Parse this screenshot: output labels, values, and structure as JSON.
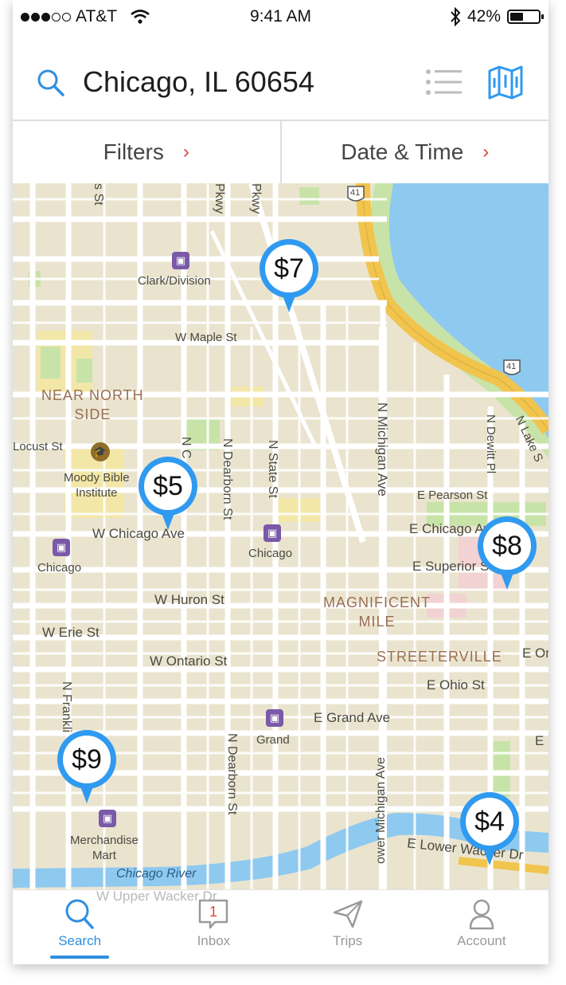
{
  "status_bar": {
    "carrier": "AT&T",
    "time": "9:41 AM",
    "battery": "42%",
    "battery_level": 0.42
  },
  "header": {
    "location": "Chicago, IL 60654"
  },
  "filters": {
    "filters_label": "Filters",
    "date_time_label": "Date & Time",
    "chevron": "›"
  },
  "map": {
    "labels": {
      "clark_division": "Clark/Division",
      "w_maple_st": "W Maple St",
      "near_north_side_1": "NEAR NORTH",
      "near_north_side_2": "SIDE",
      "locust_st": "Locust St",
      "moody_1": "Moody Bible",
      "moody_2": "Institute",
      "w_chicago_ave": "W Chicago Ave",
      "chicago_left": "Chicago",
      "chicago_mid": "Chicago",
      "w_huron_st": "W Huron St",
      "w_erie_st": "W Erie St",
      "w_ontario_st": "W Ontario St",
      "magnificent_1": "MAGNIFICENT",
      "magnificent_2": "MILE",
      "streeterville": "STREETERVILLE",
      "e_ontario": "E On",
      "e_ohio_st": "E Ohio St",
      "e_grand_ave": "E Grand Ave",
      "grand": "Grand",
      "merch_1": "Merchandise",
      "merch_2": "Mart",
      "chicago_river": "Chicago River",
      "w_upper_wacker": "W Upper Wacker Dr",
      "w_lake_st": "W Lake St",
      "e_lower_wacker": "E Lower Wacker Dr",
      "e_pearson_st": "E Pearson St",
      "e_chicago_ave": "E Chicago Av",
      "e_superior": "E Superior S",
      "n_michigan_ave": "N Michigan Ave",
      "n_michigan_ave_lower": "ower Michigan Ave",
      "n_dearborn_st": "N Dearborn St",
      "n_dearborn_st_2": "N Dearborn St",
      "n_state_st": "N State St",
      "n_dewitt_pl": "N Dewitt Pl",
      "n_lake_s": "N Lake S",
      "n_franklin": "N Frankli",
      "pkwy_1": "Pkwy",
      "pkwy_2": "Pkwy",
      "s_st": "s St",
      "n_c": "N C",
      "hwy_41": "41",
      "e_far": "E"
    },
    "prices": [
      "$7",
      "$5",
      "$8",
      "$9",
      "$4"
    ]
  },
  "tabs": [
    {
      "label": "Search",
      "active": true
    },
    {
      "label": "Inbox",
      "badge": "1"
    },
    {
      "label": "Trips"
    },
    {
      "label": "Account"
    }
  ],
  "colors": {
    "accent": "#2f8fe0",
    "pin": "#2f9af0",
    "chevron": "#e0453a",
    "water": "#8ec9f0",
    "highway": "#f1c44e",
    "park": "#c8e3a8"
  }
}
